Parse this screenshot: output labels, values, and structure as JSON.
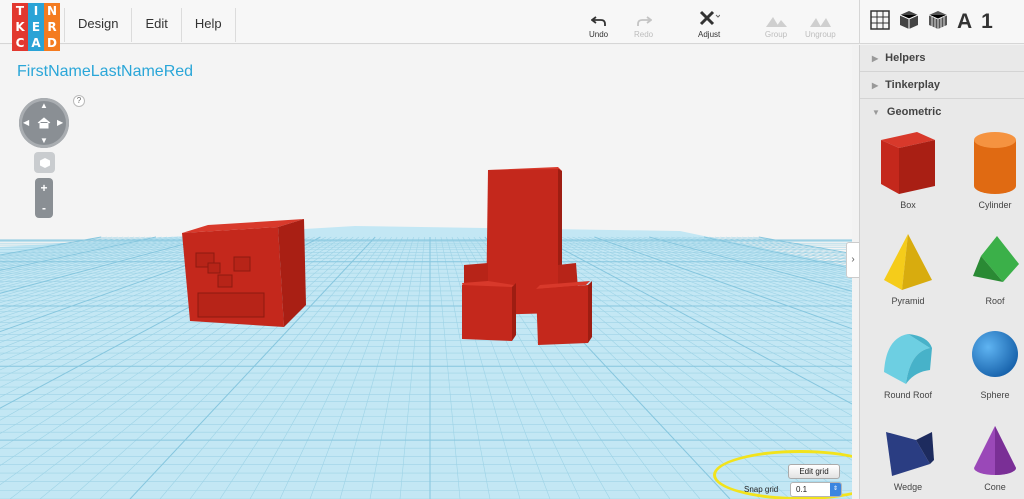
{
  "app": {
    "logo_letters": [
      "T",
      "I",
      "N",
      "K",
      "E",
      "R",
      "C",
      "A",
      "D"
    ],
    "logo_colors": [
      "#e2382f",
      "#2aa3d6",
      "#f47b20",
      "#e2382f",
      "#2aa3d6",
      "#f47b20",
      "#e2382f",
      "#2aa3d6",
      "#f47b20"
    ]
  },
  "menu": {
    "design": "Design",
    "edit": "Edit",
    "help": "Help"
  },
  "toolbar": {
    "undo": "Undo",
    "redo": "Redo",
    "adjust": "Adjust",
    "group": "Group",
    "ungroup": "Ungroup"
  },
  "view_tools": {
    "letter_a": "A",
    "number_1": "1"
  },
  "workplane": {
    "design_title": "FirstNameLastNameRed",
    "help": "?",
    "zoom_in": "+",
    "zoom_out": "-",
    "edit_grid": "Edit grid",
    "snap_grid_label": "Snap grid",
    "snap_grid_value": "0.1"
  },
  "panel": {
    "collapse_arrow": "›",
    "sections": {
      "helpers": "Helpers",
      "tinkerplay": "Tinkerplay",
      "geometric": "Geometric"
    },
    "shapes": [
      {
        "label": "Box",
        "icon": "box-icon",
        "color": "#c4281c"
      },
      {
        "label": "Cylinder",
        "icon": "cylinder-icon",
        "color": "#f07a1a"
      },
      {
        "label": "Pyramid",
        "icon": "pyramid-icon",
        "color": "#f5cc1a"
      },
      {
        "label": "Roof",
        "icon": "roof-icon",
        "color": "#2f9a3a"
      },
      {
        "label": "Round Roof",
        "icon": "round-roof-icon",
        "color": "#5cc4da"
      },
      {
        "label": "Sphere",
        "icon": "sphere-icon",
        "color": "#1f7fd0"
      },
      {
        "label": "Wedge",
        "icon": "wedge-icon",
        "color": "#22336e"
      },
      {
        "label": "Cone",
        "icon": "cone-icon",
        "color": "#8a3aa8"
      }
    ]
  },
  "colors": {
    "accent_blue": "#2aa6d8",
    "object_red": "#c4281c",
    "grid_blue": "#bfe6f3",
    "highlight_yellow": "#f2e31c"
  }
}
